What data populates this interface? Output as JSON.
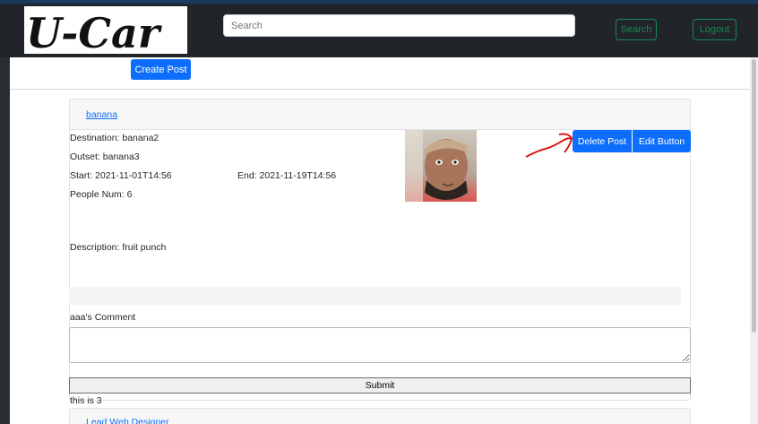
{
  "navbar": {
    "logo_text": "U-Car",
    "search_placeholder": "Search",
    "search_button": "Search",
    "logout_button": "Logout"
  },
  "toolbar": {
    "create_post_label": "Create Post"
  },
  "post": {
    "title": "banana",
    "destination": "Destination: banana2",
    "outset": "Outset: banana3",
    "start": "Start: 2021-11-01T14:56",
    "end": "End: 2021-11-19T14:56",
    "people": "People Num: 6",
    "description": "Description: fruit punch",
    "delete_label": "Delete Post",
    "edit_label": "Edit Button",
    "comment_heading": "aaa's Comment",
    "submit_label": "Submit",
    "comment_text": "this is 3"
  },
  "next_post": {
    "title": "Lead Web Designer"
  },
  "colors": {
    "primary": "#0d6efd",
    "success": "#198754",
    "navbar": "#212529",
    "annotation": "#e00000"
  }
}
